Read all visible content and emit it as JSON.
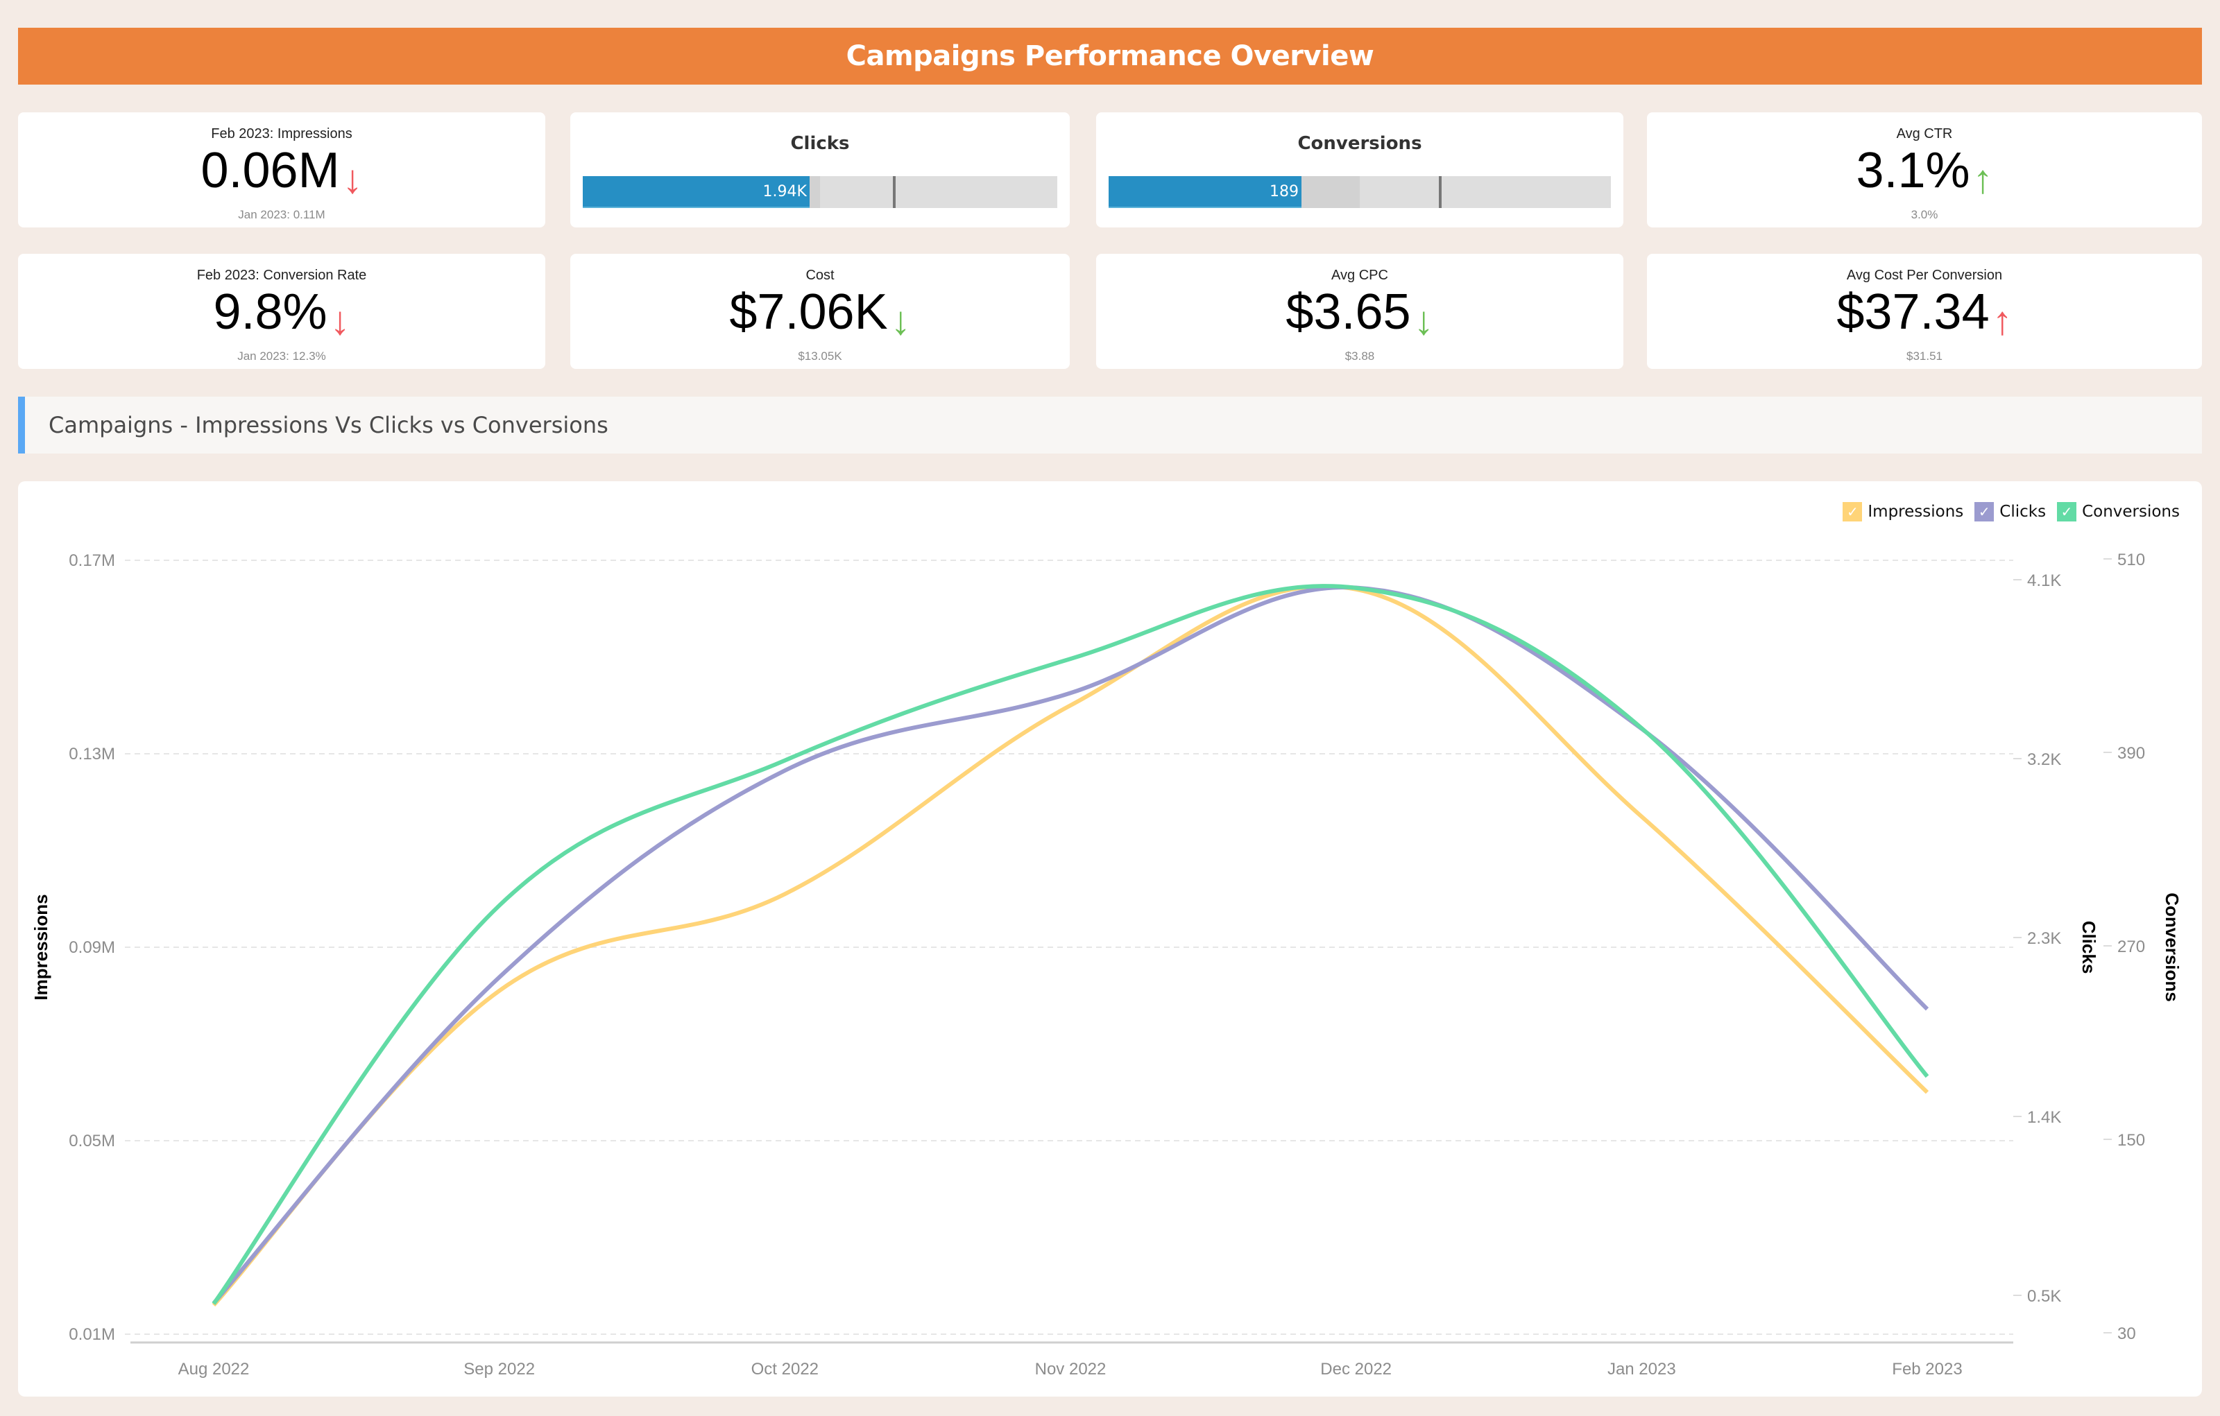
{
  "header": {
    "title": "Campaigns Performance Overview"
  },
  "kpis_row1": [
    {
      "label": "Feb 2023: Impressions",
      "value": "0.06M",
      "arrow": "↓",
      "arrow_color": "#f0595e",
      "sub": "Jan 2023: 0.11M"
    },
    {
      "type": "bullet",
      "title": "Clicks",
      "value_label": "1.94K",
      "fill_fraction": 0.478,
      "band_fraction": 0.5,
      "target_fraction": 0.653
    },
    {
      "type": "bullet",
      "title": "Conversions",
      "value_label": "189",
      "fill_fraction": 0.384,
      "band_fraction": 0.5,
      "target_fraction": 0.658
    },
    {
      "label": "Avg CTR",
      "value": "3.1%",
      "arrow": "↑",
      "arrow_color": "#6cbf55",
      "sub": "3.0%"
    }
  ],
  "kpis_row2": [
    {
      "label": "Feb 2023: Conversion Rate",
      "value": "9.8%",
      "arrow": "↓",
      "arrow_color": "#f0595e",
      "sub": "Jan 2023: 12.3%"
    },
    {
      "label": "Cost",
      "value": "$7.06K",
      "arrow": "↓",
      "arrow_color": "#6cbf55",
      "sub": "$13.05K"
    },
    {
      "label": "Avg CPC",
      "value": "$3.65",
      "arrow": "↓",
      "arrow_color": "#6cbf55",
      "sub": "$3.88"
    },
    {
      "label": "Avg Cost Per Conversion",
      "value": "$37.34",
      "arrow": "↑",
      "arrow_color": "#f0595e",
      "sub": "$31.51"
    }
  ],
  "section": {
    "title": "Campaigns - Impressions Vs Clicks vs Conversions"
  },
  "legend": [
    {
      "name": "Impressions",
      "color": "#ffd478",
      "check": "✓"
    },
    {
      "name": "Clicks",
      "color": "#9b9bcf",
      "check": "✓"
    },
    {
      "name": "Conversions",
      "color": "#62dba5",
      "check": "✓"
    }
  ],
  "chart_data": {
    "type": "line",
    "title": "Campaigns - Impressions Vs Clicks vs Conversions",
    "x": [
      "Aug 2022",
      "Sep 2022",
      "Oct 2022",
      "Nov 2022",
      "Dec 2022",
      "Jan 2023",
      "Feb 2023"
    ],
    "series": [
      {
        "name": "Impressions",
        "axis": "left",
        "color": "#ffd478",
        "values": [
          16000,
          81000,
          101000,
          140000,
          164000,
          117000,
          60000
        ]
      },
      {
        "name": "Clicks",
        "axis": "right1",
        "color": "#9b9bcf",
        "values": [
          460,
          2100,
          3140,
          3530,
          4060,
          3350,
          1940
        ]
      },
      {
        "name": "Conversions",
        "axis": "right2",
        "color": "#62dba5",
        "values": [
          48,
          295,
          385,
          448,
          492,
          405,
          189
        ]
      }
    ],
    "axes": {
      "left": {
        "label": "Impressions",
        "range": [
          10000,
          170000
        ],
        "ticks": [
          10000,
          50000,
          90000,
          130000,
          170000
        ],
        "tick_labels": [
          "0.01M",
          "0.05M",
          "0.09M",
          "0.13M",
          "0.17M"
        ]
      },
      "right1": {
        "label": "Clicks",
        "range": [
          500,
          4100
        ],
        "ticks": [
          500,
          1400,
          2300,
          3200,
          4100
        ],
        "tick_labels": [
          "0.5K",
          "1.4K",
          "2.3K",
          "3.2K",
          "4.1K"
        ]
      },
      "right2": {
        "label": "Conversions",
        "range": [
          30,
          510
        ],
        "ticks": [
          30,
          150,
          270,
          390,
          510
        ],
        "tick_labels": [
          "30",
          "150",
          "270",
          "390",
          "510"
        ]
      }
    },
    "grid": true,
    "legend_position": "top-right"
  }
}
